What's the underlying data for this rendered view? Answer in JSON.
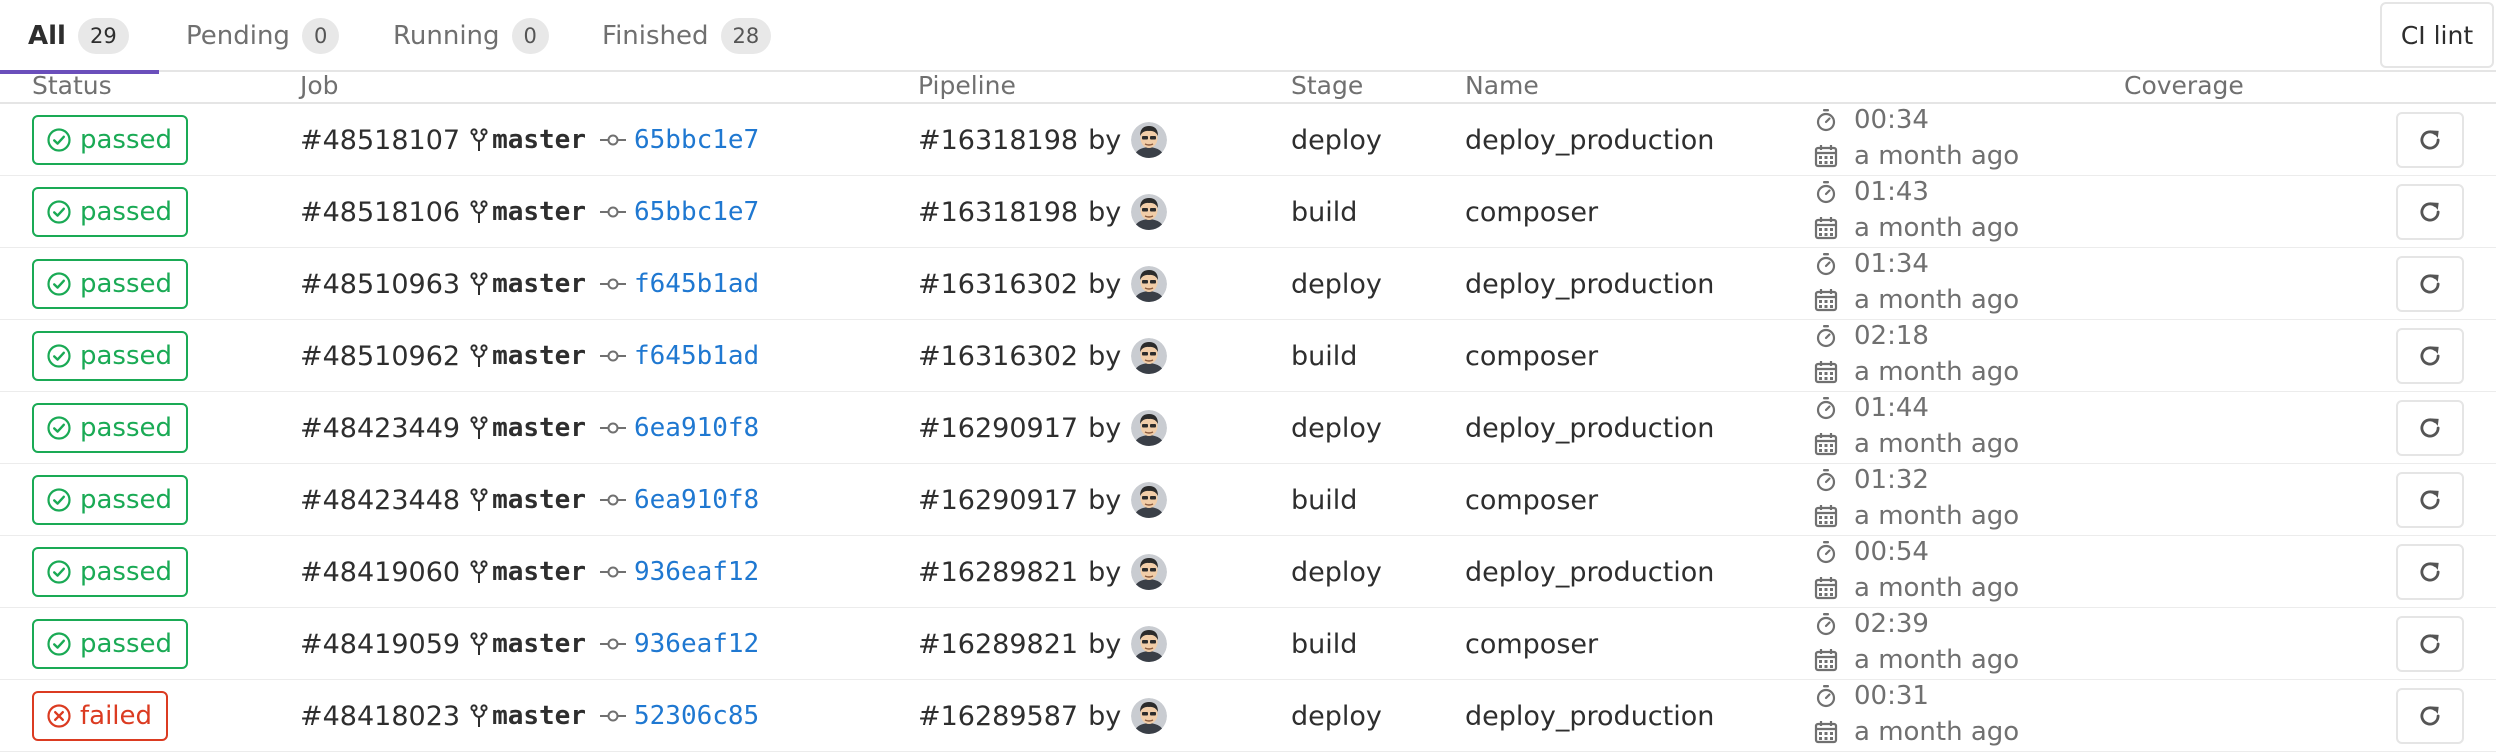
{
  "tabs": [
    {
      "label": "All",
      "count": "29",
      "active": true
    },
    {
      "label": "Pending",
      "count": "0",
      "active": false
    },
    {
      "label": "Running",
      "count": "0",
      "active": false
    },
    {
      "label": "Finished",
      "count": "28",
      "active": false
    }
  ],
  "ci_lint_label": "CI lint",
  "columns": {
    "status": "Status",
    "job": "Job",
    "pipeline": "Pipeline",
    "stage": "Stage",
    "name": "Name",
    "coverage": "Coverage"
  },
  "pipeline_by_label": "by",
  "colors": {
    "passed": "#1aaa55",
    "failed": "#db3b21",
    "link": "#1f78d1",
    "active_tab": "#6b4fbb"
  },
  "jobs": [
    {
      "status": "passed",
      "job_id": "#48518107",
      "branch": "master",
      "commit": "65bbc1e7",
      "pipeline": "#16318198",
      "stage": "deploy",
      "name": "deploy_production",
      "duration": "00:34",
      "finished": "a month ago"
    },
    {
      "status": "passed",
      "job_id": "#48518106",
      "branch": "master",
      "commit": "65bbc1e7",
      "pipeline": "#16318198",
      "stage": "build",
      "name": "composer",
      "duration": "01:43",
      "finished": "a month ago"
    },
    {
      "status": "passed",
      "job_id": "#48510963",
      "branch": "master",
      "commit": "f645b1ad",
      "pipeline": "#16316302",
      "stage": "deploy",
      "name": "deploy_production",
      "duration": "01:34",
      "finished": "a month ago"
    },
    {
      "status": "passed",
      "job_id": "#48510962",
      "branch": "master",
      "commit": "f645b1ad",
      "pipeline": "#16316302",
      "stage": "build",
      "name": "composer",
      "duration": "02:18",
      "finished": "a month ago"
    },
    {
      "status": "passed",
      "job_id": "#48423449",
      "branch": "master",
      "commit": "6ea910f8",
      "pipeline": "#16290917",
      "stage": "deploy",
      "name": "deploy_production",
      "duration": "01:44",
      "finished": "a month ago"
    },
    {
      "status": "passed",
      "job_id": "#48423448",
      "branch": "master",
      "commit": "6ea910f8",
      "pipeline": "#16290917",
      "stage": "build",
      "name": "composer",
      "duration": "01:32",
      "finished": "a month ago"
    },
    {
      "status": "passed",
      "job_id": "#48419060",
      "branch": "master",
      "commit": "936eaf12",
      "pipeline": "#16289821",
      "stage": "deploy",
      "name": "deploy_production",
      "duration": "00:54",
      "finished": "a month ago"
    },
    {
      "status": "passed",
      "job_id": "#48419059",
      "branch": "master",
      "commit": "936eaf12",
      "pipeline": "#16289821",
      "stage": "build",
      "name": "composer",
      "duration": "02:39",
      "finished": "a month ago"
    },
    {
      "status": "failed",
      "job_id": "#48418023",
      "branch": "master",
      "commit": "52306c85",
      "pipeline": "#16289587",
      "stage": "deploy",
      "name": "deploy_production",
      "duration": "00:31",
      "finished": "a month ago"
    }
  ]
}
